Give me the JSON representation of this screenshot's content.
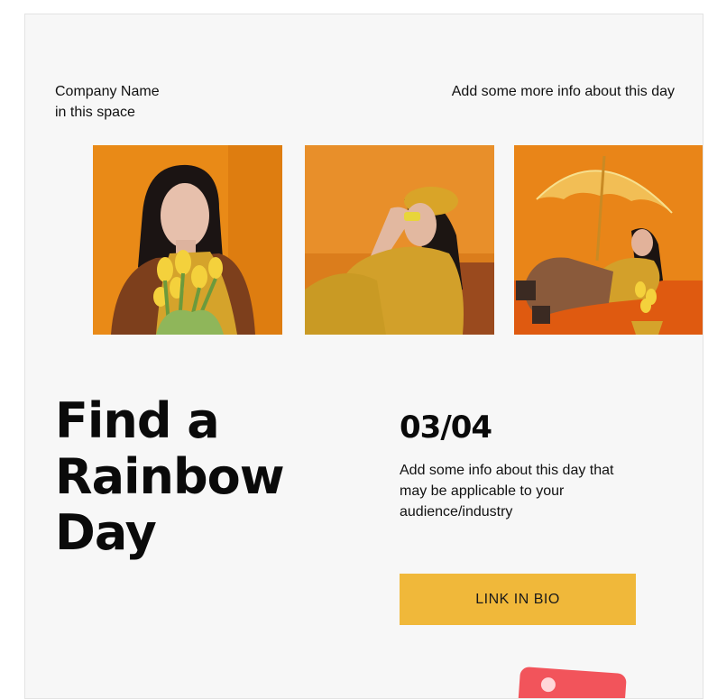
{
  "header": {
    "company_line1": "Company Name",
    "company_line2": "in this space",
    "more_info": "Add some more info about this day"
  },
  "photos": [
    {
      "alt_name": "woman-with-tulips-photo"
    },
    {
      "alt_name": "woman-with-beret-photo"
    },
    {
      "alt_name": "woman-with-umbrella-photo"
    }
  ],
  "main": {
    "headline_lines": [
      "Find a",
      "Rainbow",
      "Day"
    ],
    "date": "03/04",
    "description": "Add some info about this day that may be applicable to your audience/industry",
    "cta_label": "LINK IN BIO"
  },
  "colors": {
    "accent": "#f0b83a",
    "background": "#f7f7f7",
    "photo_orange": "#e8891a",
    "mustard": "#d4a22a",
    "sticker": "#f2545b"
  }
}
